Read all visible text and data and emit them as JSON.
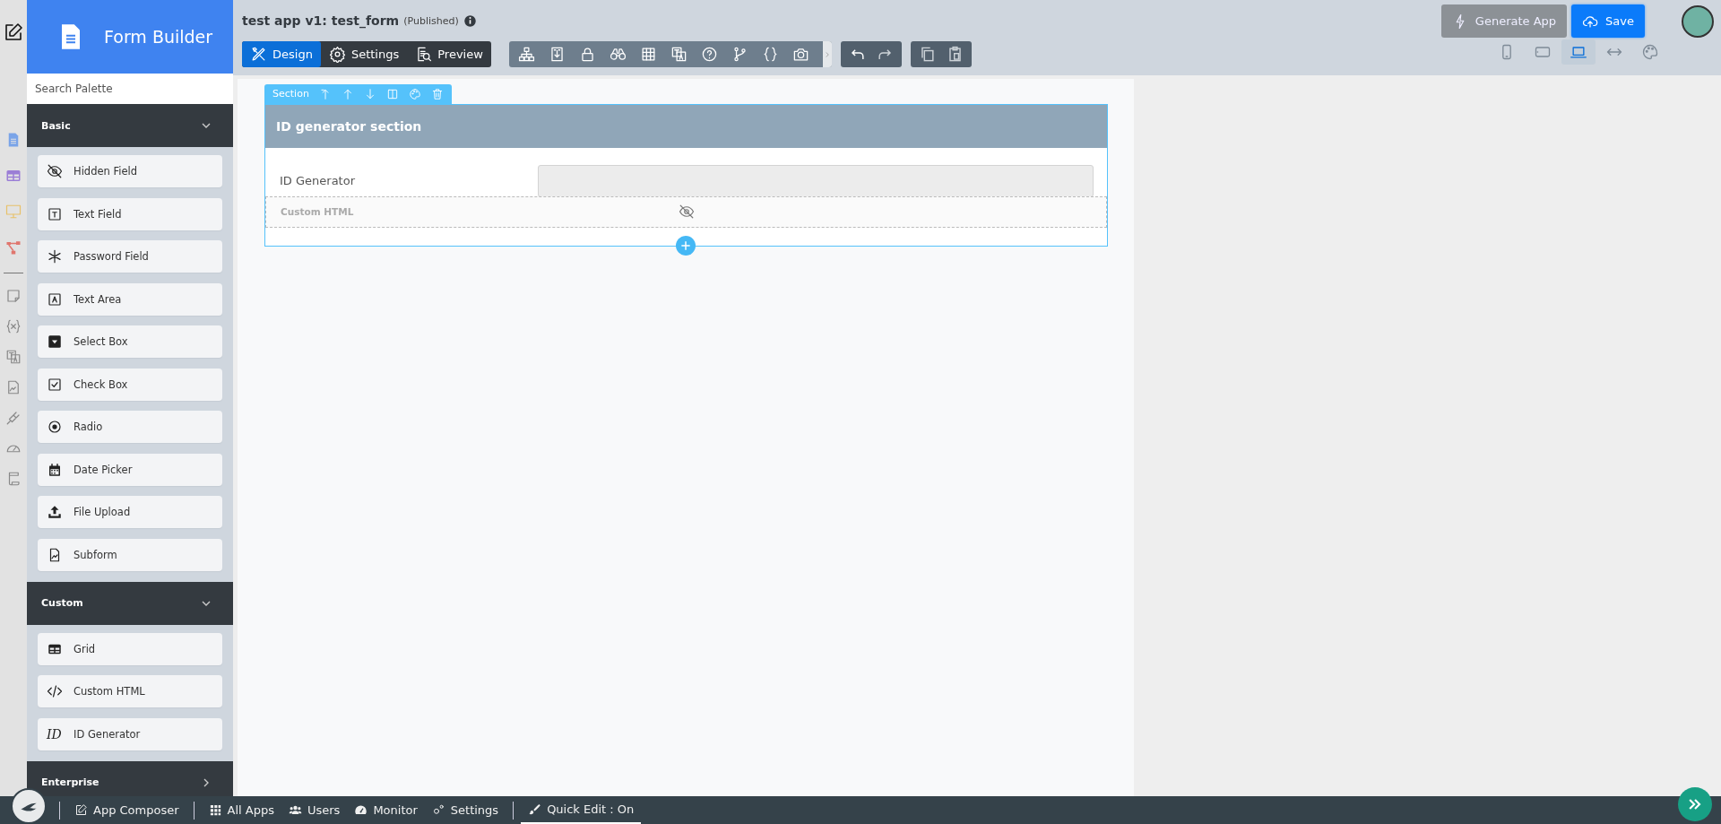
{
  "palette": {
    "title": "Form Builder",
    "search": {
      "placeholder": "Search Palette"
    },
    "groups": [
      {
        "name": "Basic",
        "expanded": true,
        "items": [
          {
            "label": "Hidden Field",
            "kind": "hidden"
          },
          {
            "label": "Text Field",
            "kind": "textfield"
          },
          {
            "label": "Password Field",
            "kind": "password"
          },
          {
            "label": "Text Area",
            "kind": "textarea"
          },
          {
            "label": "Select Box",
            "kind": "select"
          },
          {
            "label": "Check Box",
            "kind": "checkbox"
          },
          {
            "label": "Radio",
            "kind": "radio"
          },
          {
            "label": "Date Picker",
            "kind": "date"
          },
          {
            "label": "File Upload",
            "kind": "upload"
          },
          {
            "label": "Subform",
            "kind": "subform"
          }
        ]
      },
      {
        "name": "Custom",
        "expanded": true,
        "items": [
          {
            "label": "Grid",
            "kind": "grid"
          },
          {
            "label": "Custom HTML",
            "kind": "code"
          },
          {
            "label": "ID Generator",
            "kind": "id",
            "icon_text": "ID"
          }
        ]
      },
      {
        "name": "Enterprise",
        "expanded": false
      }
    ]
  },
  "header": {
    "title": "test app v1: test_form",
    "status": "(Published)"
  },
  "mode_tabs": [
    {
      "label": "Design",
      "kind": "design",
      "selected": true
    },
    {
      "label": "Settings",
      "kind": "settings",
      "selected": false
    },
    {
      "label": "Preview",
      "kind": "preview",
      "selected": false
    }
  ],
  "actions": [
    {
      "label": "Generate App",
      "kind": "generate"
    },
    {
      "label": "Save",
      "kind": "save"
    }
  ],
  "devices": [
    {
      "kind": "phone",
      "selected": false
    },
    {
      "kind": "tablet",
      "selected": false
    },
    {
      "kind": "laptop",
      "selected": true
    },
    {
      "kind": "width",
      "selected": false
    },
    {
      "kind": "palette",
      "selected": false
    }
  ],
  "section": {
    "toolbar_label": "Section",
    "title": "ID generator section",
    "fields": [
      {
        "kind": "input",
        "label": "ID Generator"
      },
      {
        "kind": "html",
        "label": "Custom HTML",
        "hidden": true
      }
    ]
  },
  "bottom_bar": {
    "items": [
      {
        "label": "App Composer",
        "kind": "composer"
      },
      {
        "label": "All Apps",
        "kind": "apps"
      },
      {
        "label": "Users",
        "kind": "users"
      },
      {
        "label": "Monitor",
        "kind": "monitor"
      },
      {
        "label": "Settings",
        "kind": "gears"
      }
    ],
    "quick_edit": {
      "label": "Quick Edit : On",
      "on": true
    }
  }
}
